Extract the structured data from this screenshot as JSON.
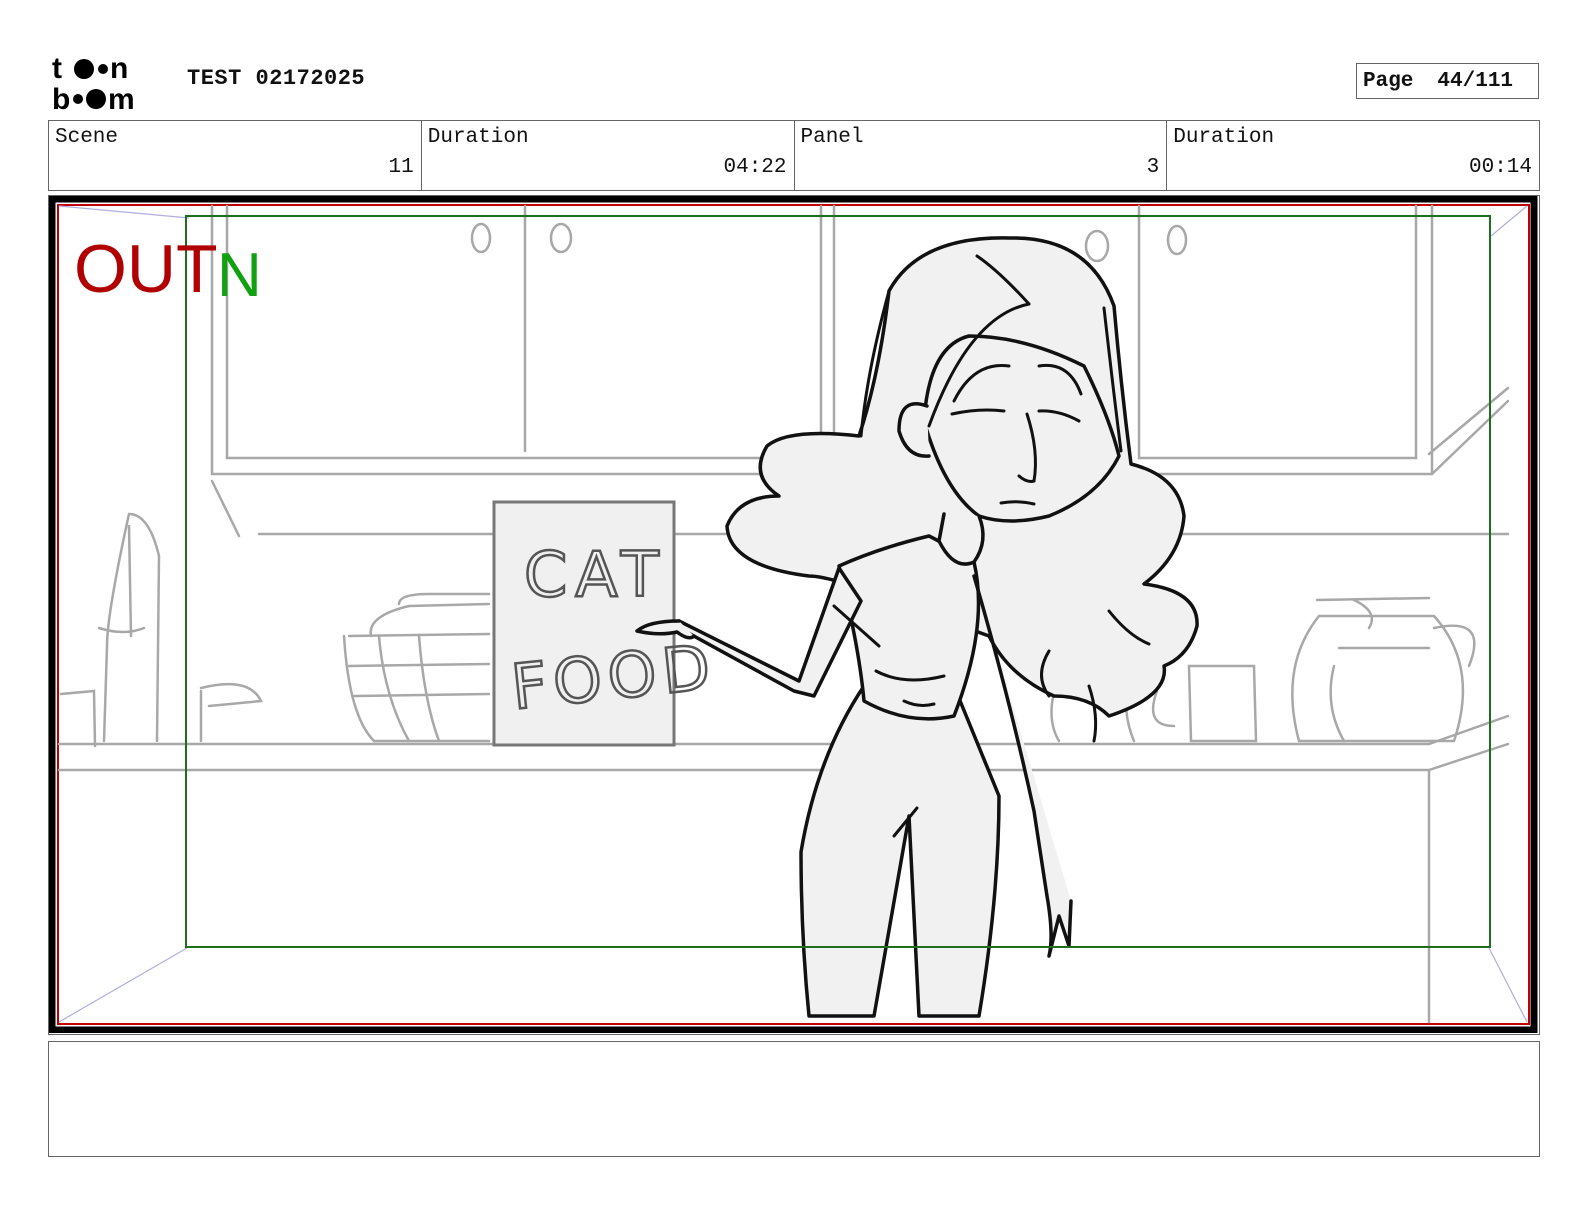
{
  "header": {
    "logo_text": "toon boom",
    "project_title": "TEST 02172025",
    "page_label": "Page",
    "page_number": "44/111"
  },
  "info": {
    "scene_label": "Scene",
    "scene_value": "11",
    "scene_duration_label": "Duration",
    "scene_duration_value": "04:22",
    "panel_label": "Panel",
    "panel_value": "3",
    "panel_duration_label": "Duration",
    "panel_duration_value": "00:14"
  },
  "panel": {
    "overlay_out": "OUT",
    "overlay_in": "N",
    "box_line1": "CAT",
    "box_line2": "FOOD"
  },
  "colors": {
    "out_red": "#b00000",
    "in_green": "#10a010",
    "safe_area_green": "#1e6e1e",
    "frame_red": "#c00000",
    "sketch_gray": "#9a9a9a"
  },
  "notes": {
    "text": ""
  }
}
